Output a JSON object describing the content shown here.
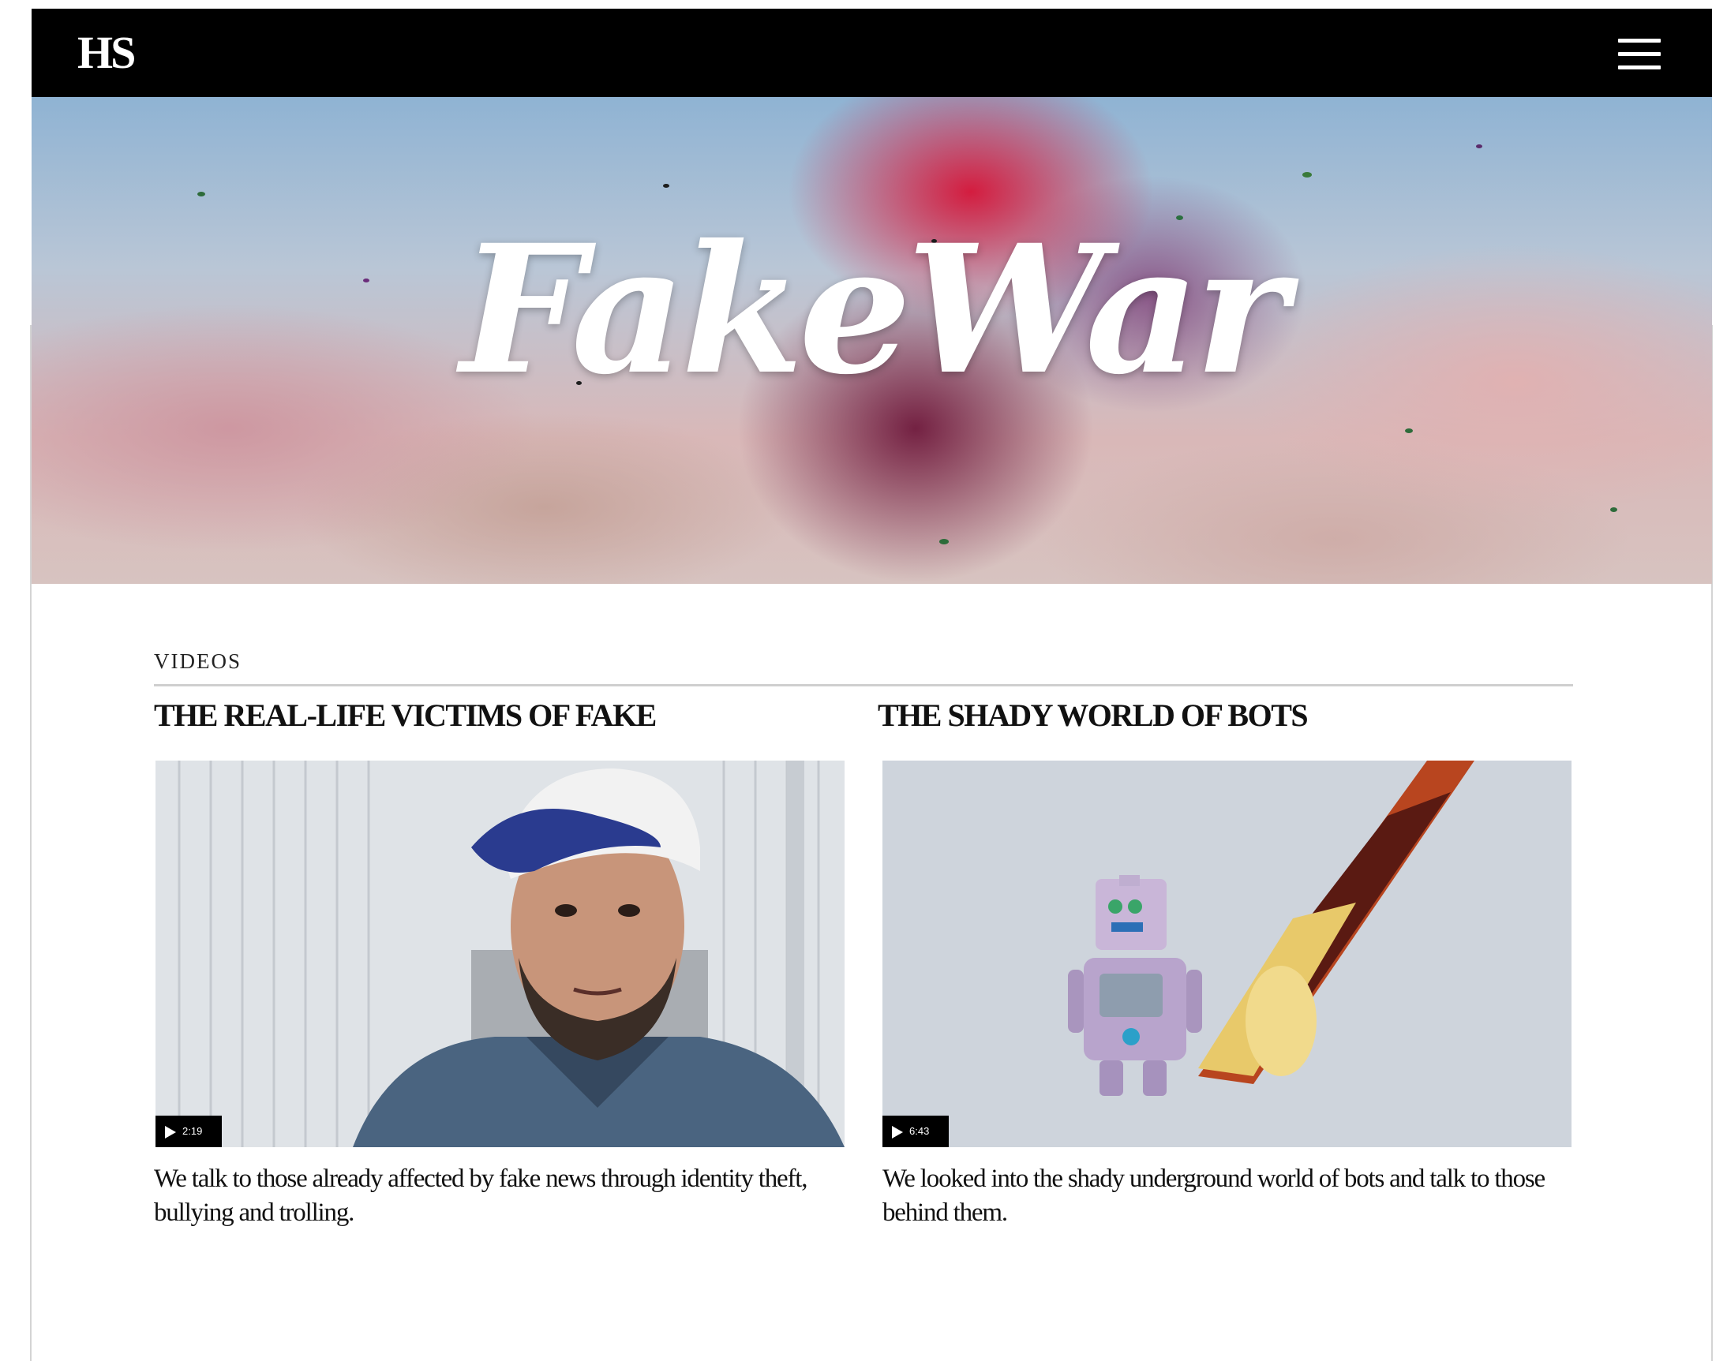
{
  "header": {
    "logo_text": "HS",
    "menu_icon": "hamburger-icon"
  },
  "hero": {
    "title": "FakeWar"
  },
  "section": {
    "label": "VIDEOS"
  },
  "videos": [
    {
      "headline": "THE REAL-LIFE VICTIMS OF FAKE",
      "duration": "2:19",
      "caption": "We talk to those already affected by fake news through identity theft, bullying and trolling."
    },
    {
      "headline": "THE SHADY WORLD OF BOTS",
      "duration": "6:43",
      "caption": "We looked into the shady underground world of bots and talk to those behind them."
    }
  ],
  "colors": {
    "topbar": "#000000",
    "page": "#ffffff",
    "rule": "#cfcfcf",
    "text": "#111111"
  }
}
